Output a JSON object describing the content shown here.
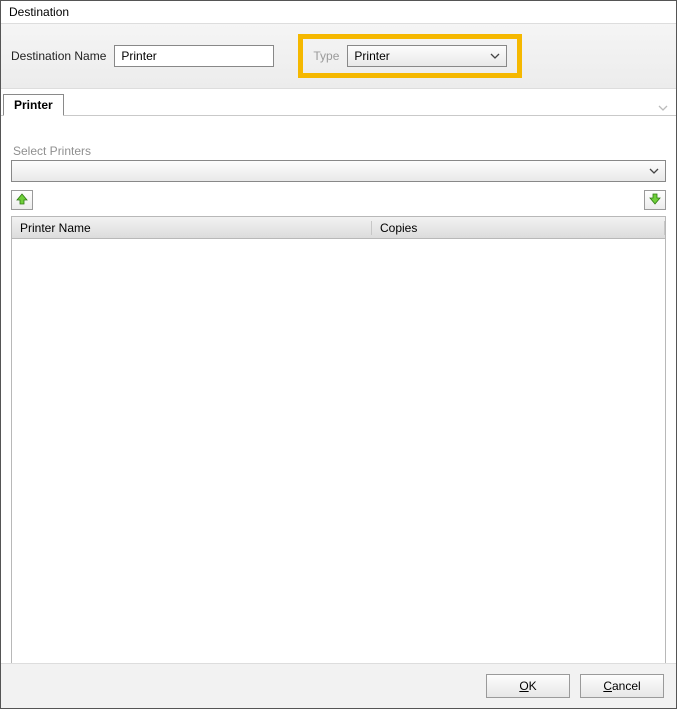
{
  "window": {
    "title": "Destination"
  },
  "header": {
    "dest_name_label": "Destination Name",
    "dest_name_value": "Printer",
    "type_label": "Type",
    "type_value": "Printer"
  },
  "tabs": {
    "active": "Printer"
  },
  "section": {
    "select_printers_label": "Select Printers"
  },
  "grid": {
    "columns": [
      {
        "label": "Printer Name"
      },
      {
        "label": "Copies"
      }
    ],
    "rows": []
  },
  "footer": {
    "ok_label": "OK",
    "cancel_label": "Cancel"
  }
}
